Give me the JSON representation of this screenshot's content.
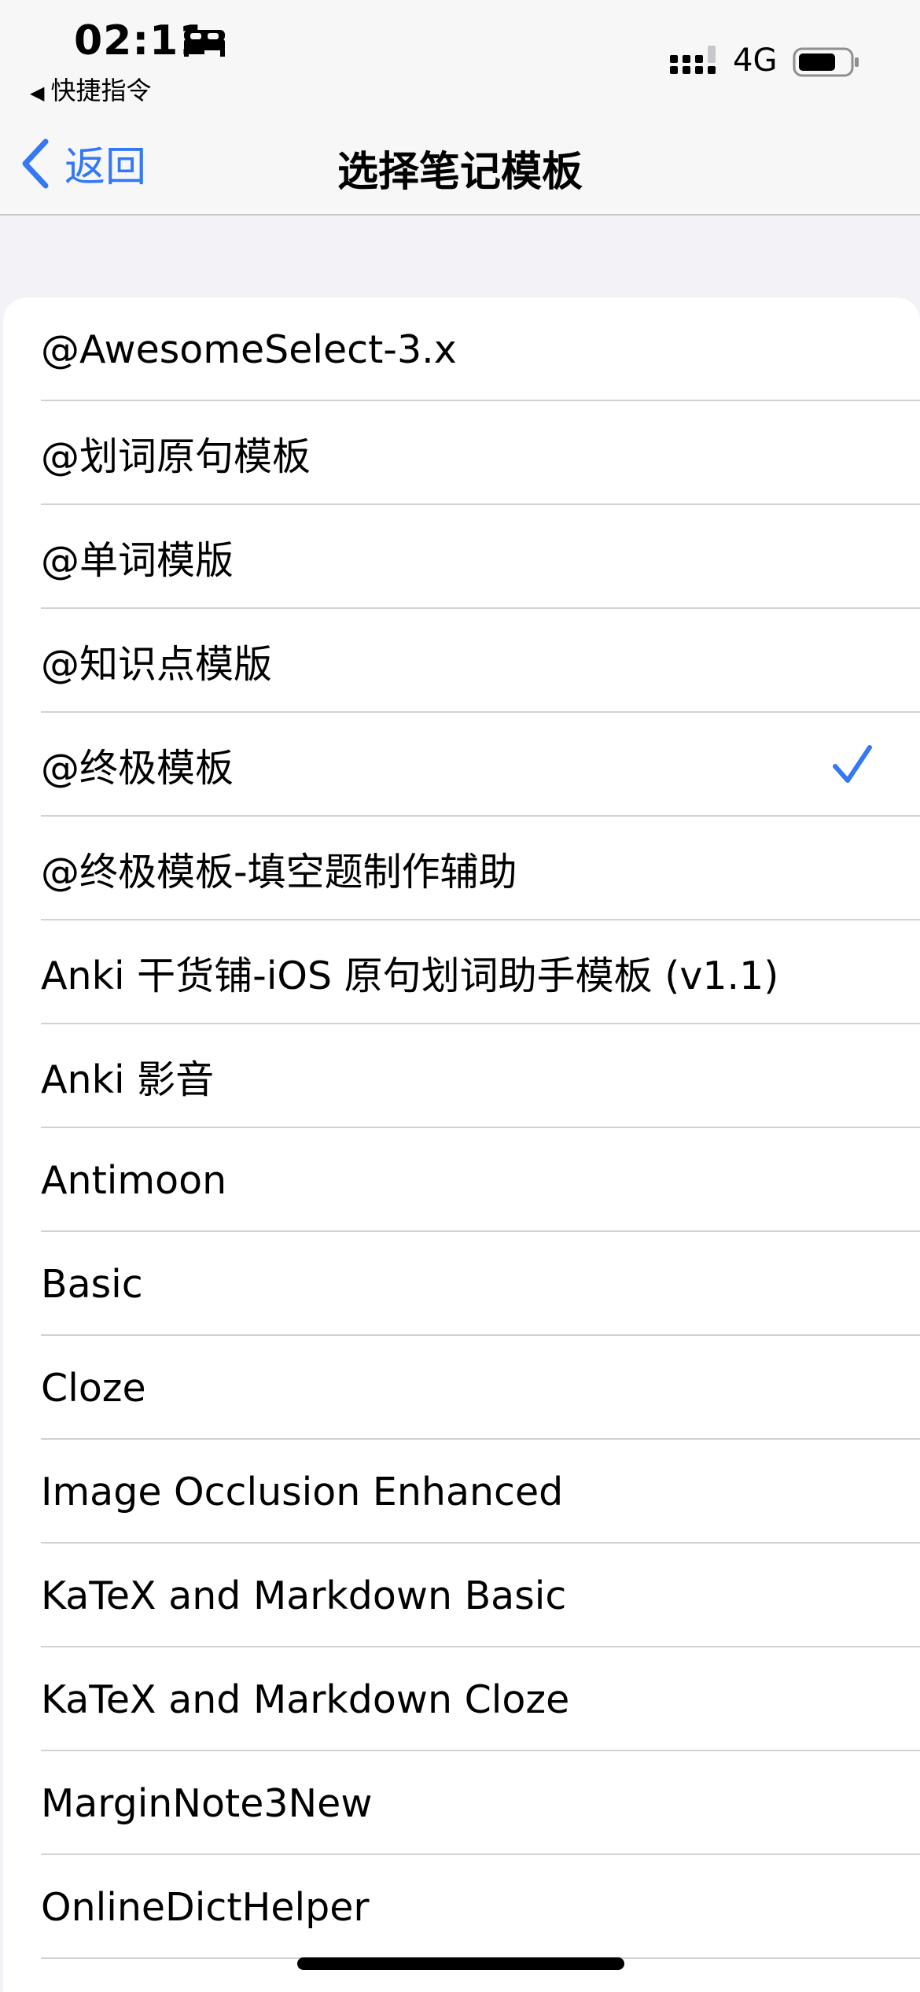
{
  "status_bar": {
    "time": "02:11",
    "back_app": "快捷指令",
    "network": "4G"
  },
  "nav": {
    "back_label": "返回",
    "title": "选择笔记模板"
  },
  "templates": [
    {
      "label": "@AwesomeSelect-3.x",
      "selected": false
    },
    {
      "label": "@划词原句模板",
      "selected": false
    },
    {
      "label": "@单词模版",
      "selected": false
    },
    {
      "label": "@知识点模版",
      "selected": false
    },
    {
      "label": "@终极模板",
      "selected": true
    },
    {
      "label": "@终极模板-填空题制作辅助",
      "selected": false
    },
    {
      "label": "Anki 干货铺-iOS 原句划词助手模板 (v1.1)",
      "selected": false
    },
    {
      "label": "Anki 影音",
      "selected": false
    },
    {
      "label": "Antimoon",
      "selected": false
    },
    {
      "label": "Basic",
      "selected": false
    },
    {
      "label": "Cloze",
      "selected": false
    },
    {
      "label": "Image Occlusion Enhanced",
      "selected": false
    },
    {
      "label": "KaTeX and Markdown Basic",
      "selected": false
    },
    {
      "label": "KaTeX and Markdown Cloze",
      "selected": false
    },
    {
      "label": "MarginNote3New",
      "selected": false
    },
    {
      "label": "OnlineDictHelper",
      "selected": false
    }
  ],
  "colors": {
    "accent": "#3478f6",
    "background": "#f2f2f7"
  }
}
